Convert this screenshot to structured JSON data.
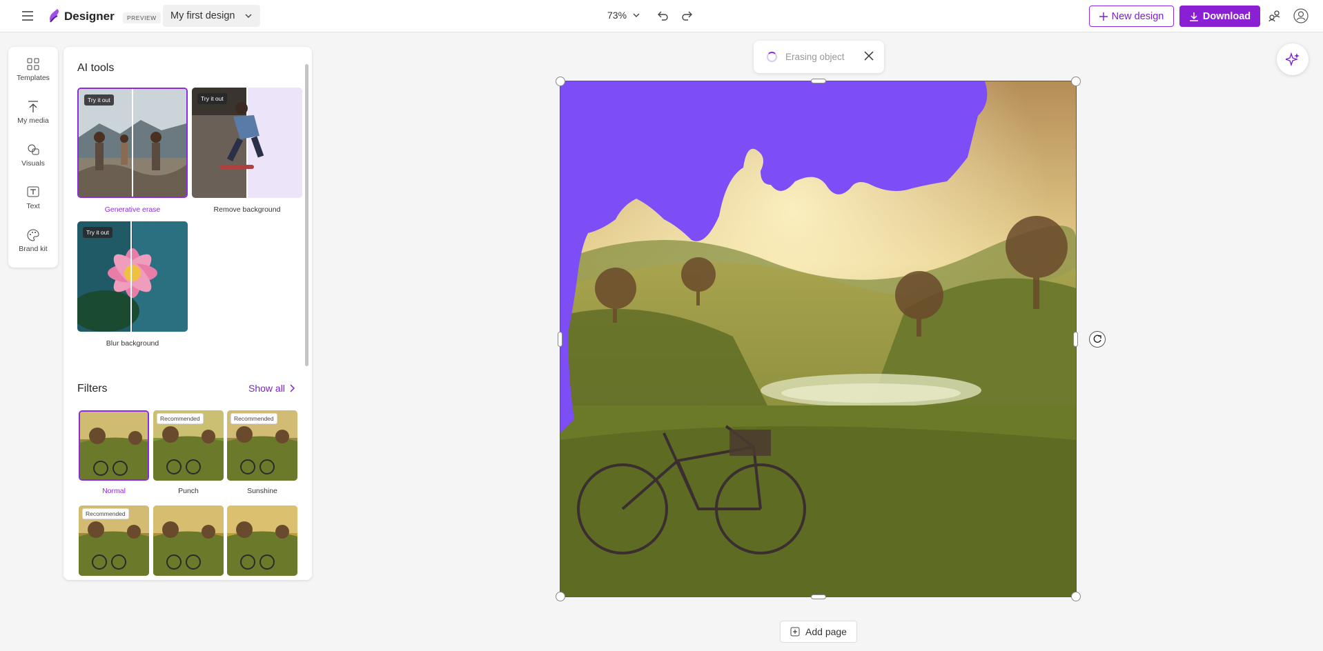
{
  "header": {
    "menu_icon": "hamburger-icon",
    "brand": "Designer",
    "badge": "PREVIEW",
    "doc_name": "My first design",
    "zoom": "73%",
    "new_design": "New design",
    "download": "Download"
  },
  "rail": {
    "items": [
      {
        "label": "Templates",
        "icon": "templates-icon"
      },
      {
        "label": "My media",
        "icon": "upload-icon"
      },
      {
        "label": "Visuals",
        "icon": "visuals-icon"
      },
      {
        "label": "Text",
        "icon": "text-icon"
      },
      {
        "label": "Brand kit",
        "icon": "palette-icon"
      }
    ]
  },
  "panel": {
    "ai_title": "AI tools",
    "tools": [
      {
        "label": "Generative erase",
        "badge": "Try it out"
      },
      {
        "label": "Remove background",
        "badge": "Try it out"
      },
      {
        "label": "Blur background",
        "badge": "Try it out"
      }
    ],
    "filters_title": "Filters",
    "show_all": "Show all",
    "filters": [
      {
        "label": "Normal",
        "badge": ""
      },
      {
        "label": "Punch",
        "badge": "Recommended"
      },
      {
        "label": "Sunshine",
        "badge": "Recommended"
      },
      {
        "label": "",
        "badge": "Recommended"
      },
      {
        "label": "",
        "badge": ""
      },
      {
        "label": "",
        "badge": ""
      }
    ]
  },
  "toast": {
    "text": "Erasing object"
  },
  "canvas": {
    "erase_mask_color": "#7d4df5",
    "selection_color": "#7b2be2"
  },
  "footer": {
    "add_page": "Add page"
  },
  "colors": {
    "accent": "#8a1fd6"
  }
}
